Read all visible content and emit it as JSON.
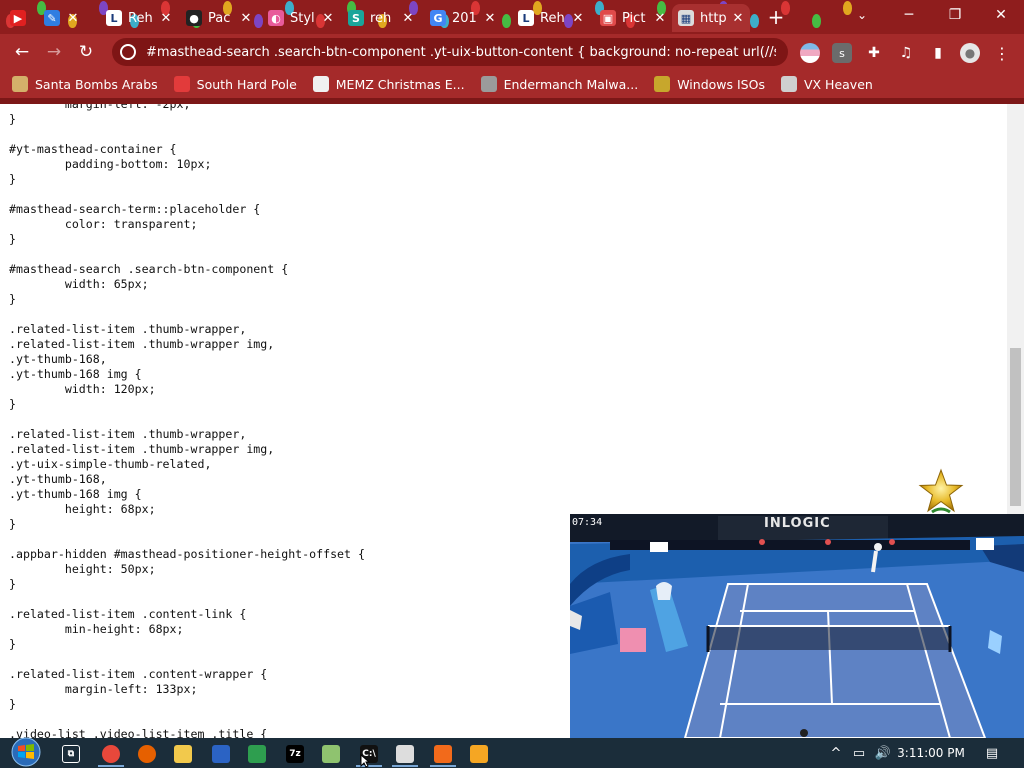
{
  "browser": {
    "tabs": [
      {
        "label": "",
        "favicon_color": "#e02020",
        "favicon_glyph": "▶",
        "favicon_icon": "youtube-icon",
        "active": false
      },
      {
        "label": "",
        "favicon_color": "#2f7de1",
        "favicon_glyph": "✎",
        "favicon_icon": "edit-icon",
        "active": false
      },
      {
        "label": "Reh",
        "favicon_color": "#ffffff",
        "favicon_glyph": "L",
        "favicon_icon": "letter-l-icon",
        "active": false
      },
      {
        "label": "Pac",
        "favicon_color": "#222222",
        "favicon_glyph": "●",
        "favicon_icon": "dark-circle-icon",
        "active": false
      },
      {
        "label": "Styl",
        "favicon_color": "#e85b9a",
        "favicon_glyph": "◐",
        "favicon_icon": "stylus-icon",
        "active": false
      },
      {
        "label": "reh",
        "favicon_color": "#1aa59a",
        "favicon_glyph": "S",
        "favicon_icon": "letter-s-icon",
        "active": false
      },
      {
        "label": "201",
        "favicon_color": "#4285f4",
        "favicon_glyph": "G",
        "favicon_icon": "google-icon",
        "active": false
      },
      {
        "label": "Reh",
        "favicon_color": "#ffffff",
        "favicon_glyph": "L",
        "favicon_icon": "letter-l-icon",
        "active": false
      },
      {
        "label": "Pict",
        "favicon_color": "#e04a4a",
        "favicon_glyph": "▣",
        "favicon_icon": "picture-icon",
        "active": false
      },
      {
        "label": "http",
        "favicon_color": "#dcdcdc",
        "favicon_glyph": "▦",
        "favicon_icon": "page-icon",
        "active": true
      }
    ],
    "close_glyph": "✕",
    "new_tab_glyph": "+",
    "tab_search_glyph": "⌄",
    "window_controls": {
      "minimize": "─",
      "restore": "❐",
      "close": "✕"
    },
    "nav": {
      "back": "←",
      "forward": "→",
      "reload": "↻"
    },
    "address": "#masthead-search .search-btn-component .yt-uix-button-content { background: no-repeat url(//s.yti...",
    "extension_glyphs": {
      "s_extension": "s",
      "puzzle": "✚",
      "media": "♫",
      "sidepanel": "▮",
      "profile": "●",
      "menu": "⋮"
    },
    "bookmarks": [
      {
        "label": "Santa Bombs Arabs",
        "icon_color": "#d4b06a"
      },
      {
        "label": "South Hard Pole",
        "icon_color": "#e23b3b"
      },
      {
        "label": "MEMZ Christmas E...",
        "icon_color": "#f0f0f0"
      },
      {
        "label": "Endermanch Malwa...",
        "icon_color": "#9b9b9b"
      },
      {
        "label": "Windows ISOs",
        "icon_color": "#c7a72c"
      },
      {
        "label": "VX Heaven",
        "icon_color": "#cfcfcf"
      }
    ]
  },
  "code_lines": [
    "        margin-left: -2px;",
    "}",
    "",
    "#yt-masthead-container {",
    "        padding-bottom: 10px;",
    "}",
    "",
    "#masthead-search-term::placeholder {",
    "        color: transparent;",
    "}",
    "",
    "#masthead-search .search-btn-component {",
    "        width: 65px;",
    "}",
    "",
    ".related-list-item .thumb-wrapper,",
    ".related-list-item .thumb-wrapper img,",
    ".yt-thumb-168,",
    ".yt-thumb-168 img {",
    "        width: 120px;",
    "}",
    "",
    ".related-list-item .thumb-wrapper,",
    ".related-list-item .thumb-wrapper img,",
    ".yt-uix-simple-thumb-related,",
    ".yt-thumb-168,",
    ".yt-thumb-168 img {",
    "        height: 68px;",
    "}",
    "",
    ".appbar-hidden #masthead-positioner-height-offset {",
    "        height: 50px;",
    "}",
    "",
    ".related-list-item .content-link {",
    "        min-height: 68px;",
    "}",
    "",
    ".related-list-item .content-wrapper {",
    "        margin-left: 133px;",
    "}",
    "",
    ".video-list .video-list-item .title {"
  ],
  "video": {
    "timestamp": "07:34",
    "brand": "INLOGIC"
  },
  "taskbar": {
    "apps": [
      {
        "name": "task-view",
        "color": "#1b2d3a",
        "glyph": "⧉",
        "running": false
      },
      {
        "name": "chrome",
        "color": "#e8483b",
        "glyph": "",
        "running": true
      },
      {
        "name": "firefox",
        "color": "#e66000",
        "glyph": "",
        "running": false
      },
      {
        "name": "file-explorer",
        "color": "#f2c94c",
        "glyph": "",
        "running": false
      },
      {
        "name": "powershell",
        "color": "#2b63c4",
        "glyph": "",
        "running": false
      },
      {
        "name": "green-app",
        "color": "#2e9e4f",
        "glyph": "",
        "running": false
      },
      {
        "name": "7zip",
        "color": "#000000",
        "glyph": "7z",
        "running": false
      },
      {
        "name": "notepadpp",
        "color": "#8fc36f",
        "glyph": "",
        "running": false
      },
      {
        "name": "cmd",
        "color": "#111111",
        "glyph": "C:\\",
        "running": true
      },
      {
        "name": "qr-app",
        "color": "#dddddd",
        "glyph": "",
        "running": true
      },
      {
        "name": "xampp",
        "color": "#f26a1b",
        "glyph": "",
        "running": true
      },
      {
        "name": "search-app",
        "color": "#f5a623",
        "glyph": "",
        "running": false
      }
    ],
    "tray": {
      "chevron": "^",
      "network": "▭",
      "volume": "🔊",
      "notifications": "▤"
    },
    "clock": "3:11:00 PM"
  }
}
